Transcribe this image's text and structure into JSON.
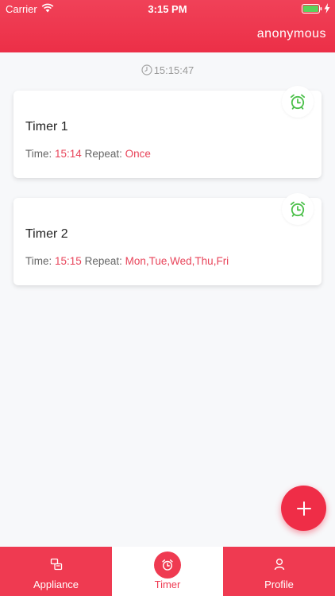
{
  "status_bar": {
    "carrier": "Carrier",
    "time": "3:15 PM"
  },
  "header": {
    "username": "anonymous"
  },
  "server_time": "15:15:47",
  "timers": [
    {
      "title": "Timer 1",
      "time_label": "Time:",
      "time": "15:14",
      "repeat_label": "Repeat:",
      "repeat": "Once",
      "icon": "alarm-clock-icon"
    },
    {
      "title": "Timer 2",
      "time_label": "Time:",
      "time": "15:15",
      "repeat_label": "Repeat:",
      "repeat": "Mon,Tue,Wed,Thu,Fri",
      "icon": "alarm-clock-icon"
    }
  ],
  "tabs": [
    {
      "label": "Appliance",
      "icon": "appliance-icon",
      "active": false
    },
    {
      "label": "Timer",
      "icon": "alarm-clock-icon",
      "active": true
    },
    {
      "label": "Profile",
      "icon": "person-icon",
      "active": false
    }
  ],
  "colors": {
    "accent": "#ef2d47",
    "alarm_green": "#4cc04a",
    "value_red": "#e8445a"
  }
}
